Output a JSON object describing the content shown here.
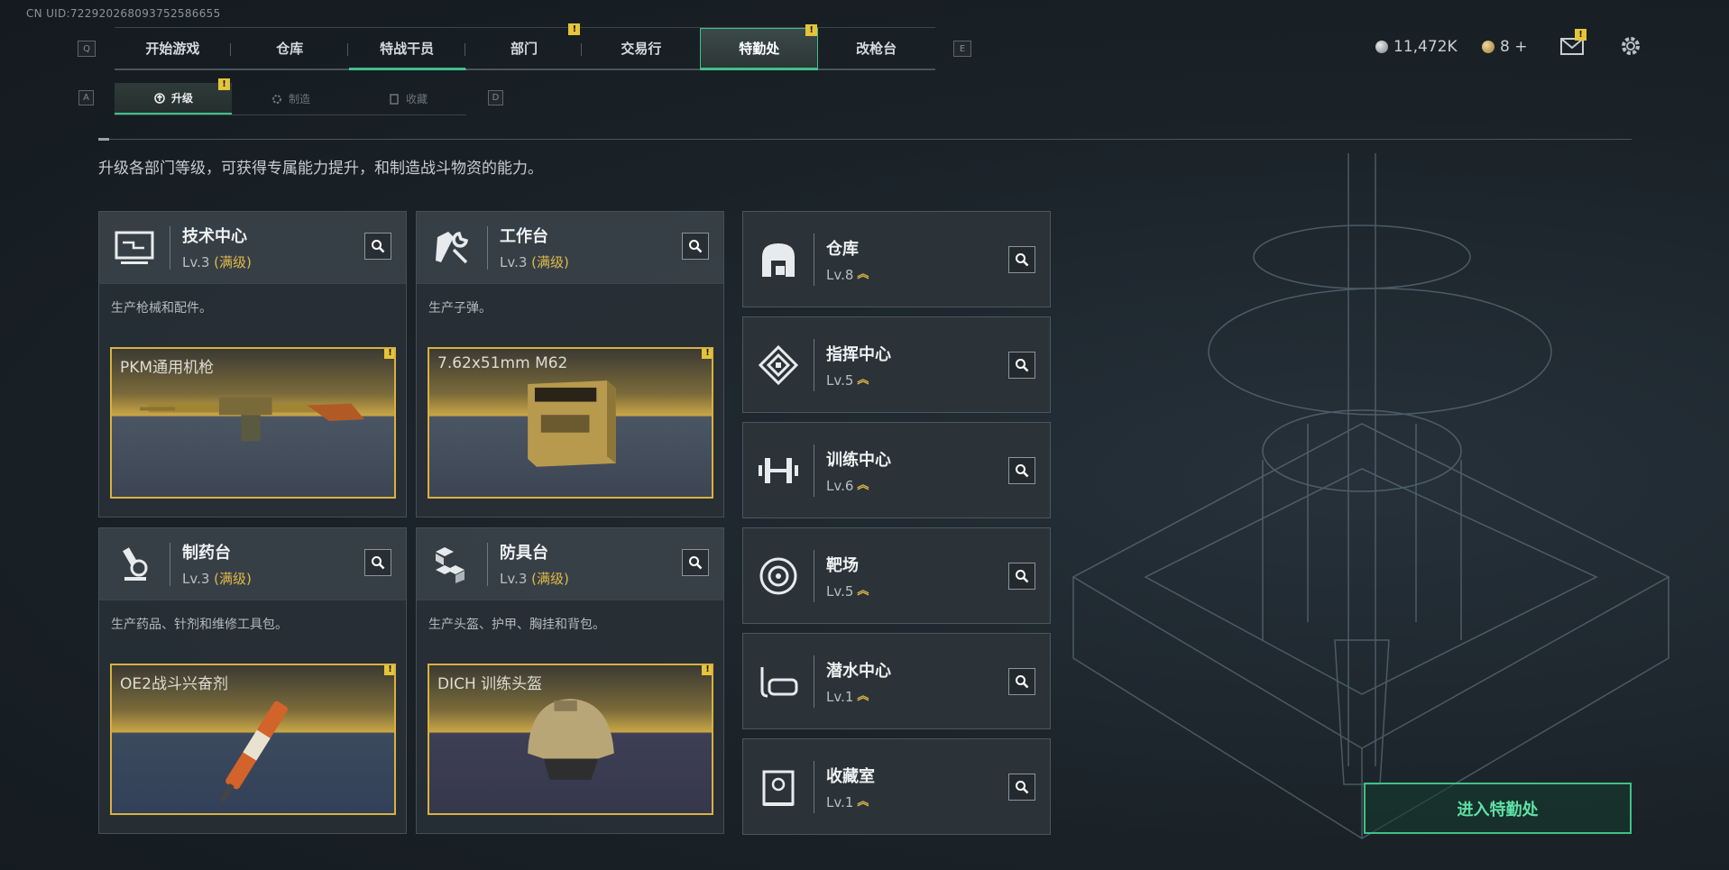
{
  "uid": "CN UID:722920268093752586655",
  "keys": {
    "left_main": "Q",
    "right_main": "E",
    "left_sub": "A",
    "right_sub": "D"
  },
  "nav": {
    "tabs": [
      {
        "label": "开始游戏"
      },
      {
        "label": "仓库"
      },
      {
        "label": "特战干员"
      },
      {
        "label": "部门",
        "badge": "!"
      },
      {
        "label": "交易行"
      },
      {
        "label": "特勤处",
        "badge": "!"
      },
      {
        "label": "改枪台"
      }
    ]
  },
  "currency": {
    "silver": "11,472K",
    "gold": "8 +"
  },
  "mail_badge": "!",
  "subtabs": [
    {
      "label": "升级",
      "badge": "!"
    },
    {
      "label": "制造"
    },
    {
      "label": "收藏"
    }
  ],
  "subtitle": "升级各部门等级，可获得专属能力提升，和制造战斗物资的能力。",
  "cards": [
    {
      "name": "技术中心",
      "lv": "Lv.3",
      "max": "(满级)",
      "desc": "生产枪械和配件。",
      "item": "PKM通用机枪",
      "item_badge": "!"
    },
    {
      "name": "工作台",
      "lv": "Lv.3",
      "max": "(满级)",
      "desc": "生产子弹。",
      "item": "7.62x51mm M62",
      "item_badge": "!"
    },
    {
      "name": "制药台",
      "lv": "Lv.3",
      "max": "(满级)",
      "desc": "生产药品、针剂和维修工具包。",
      "item": "OE2战斗兴奋剂",
      "item_badge": "!"
    },
    {
      "name": "防具台",
      "lv": "Lv.3",
      "max": "(满级)",
      "desc": "生产头盔、护甲、胸挂和背包。",
      "item": "DICH 训练头盔",
      "item_badge": "!"
    }
  ],
  "facilities": [
    {
      "name": "仓库",
      "lv": "Lv.8",
      "icon": "vault-icon"
    },
    {
      "name": "指挥中心",
      "lv": "Lv.5",
      "icon": "command-icon"
    },
    {
      "name": "训练中心",
      "lv": "Lv.6",
      "icon": "dumbbell-icon"
    },
    {
      "name": "靶场",
      "lv": "Lv.5",
      "icon": "target-icon"
    },
    {
      "name": "潜水中心",
      "lv": "Lv.1",
      "icon": "dive-mask-icon"
    },
    {
      "name": "收藏室",
      "lv": "Lv.1",
      "icon": "collection-icon"
    }
  ],
  "enter_button": "进入特勤处",
  "colors": {
    "accent": "#3fc08a",
    "gold": "#e0b94a",
    "badge": "#e5c43b"
  }
}
